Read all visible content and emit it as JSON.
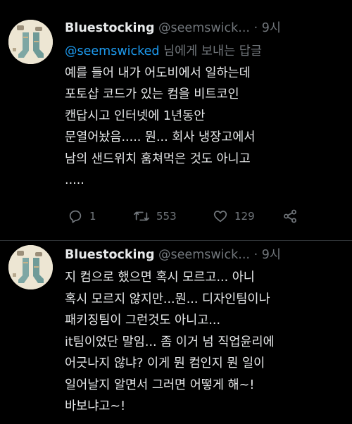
{
  "tweets": [
    {
      "author_name": "Bluestocking",
      "author_handle": "@seemswick...",
      "separator": "·",
      "time": "9시",
      "reply_to_mention": "@seemswicked",
      "reply_to_suffix": " 님에게 보내는 답글",
      "lines": [
        "예를 들어 내가 어도비에서 일하는데",
        "포토샵 코드가 있는 컴을 비트코인",
        "캔답시고 인터넷에 1년동안",
        "문열어놨음..... 뭔... 회사 냉장고에서",
        "남의 샌드위치 훔쳐먹은 것도 아니고",
        "....."
      ],
      "actions": {
        "reply_count": "1",
        "retweet_count": "553",
        "like_count": "129"
      }
    },
    {
      "author_name": "Bluestocking",
      "author_handle": "@seemswick...",
      "separator": "·",
      "time": "9시",
      "lines": [
        "지 컴으로 했으면 혹시 모르고... 아니",
        "혹시 모르지 않지만...뭔... 디자인팀이나",
        "패키징팀이 그런것도 아니고...",
        "it팀이었단 말임... 좀 이거 넘 직업윤리에",
        "어긋나지 않냐? 이게 뭔 컴인지 뭔 일이",
        "일어날지 알면서 그러면 어떻게 해~!",
        "바보냐고~!"
      ]
    }
  ],
  "colors": {
    "background": "#000000",
    "text": "#e7e9ea",
    "muted": "#71767b",
    "mention": "#1d9bf0",
    "divider": "#2f3336"
  },
  "icons": [
    "reply-icon",
    "retweet-icon",
    "like-icon",
    "share-icon",
    "avatar-image"
  ]
}
